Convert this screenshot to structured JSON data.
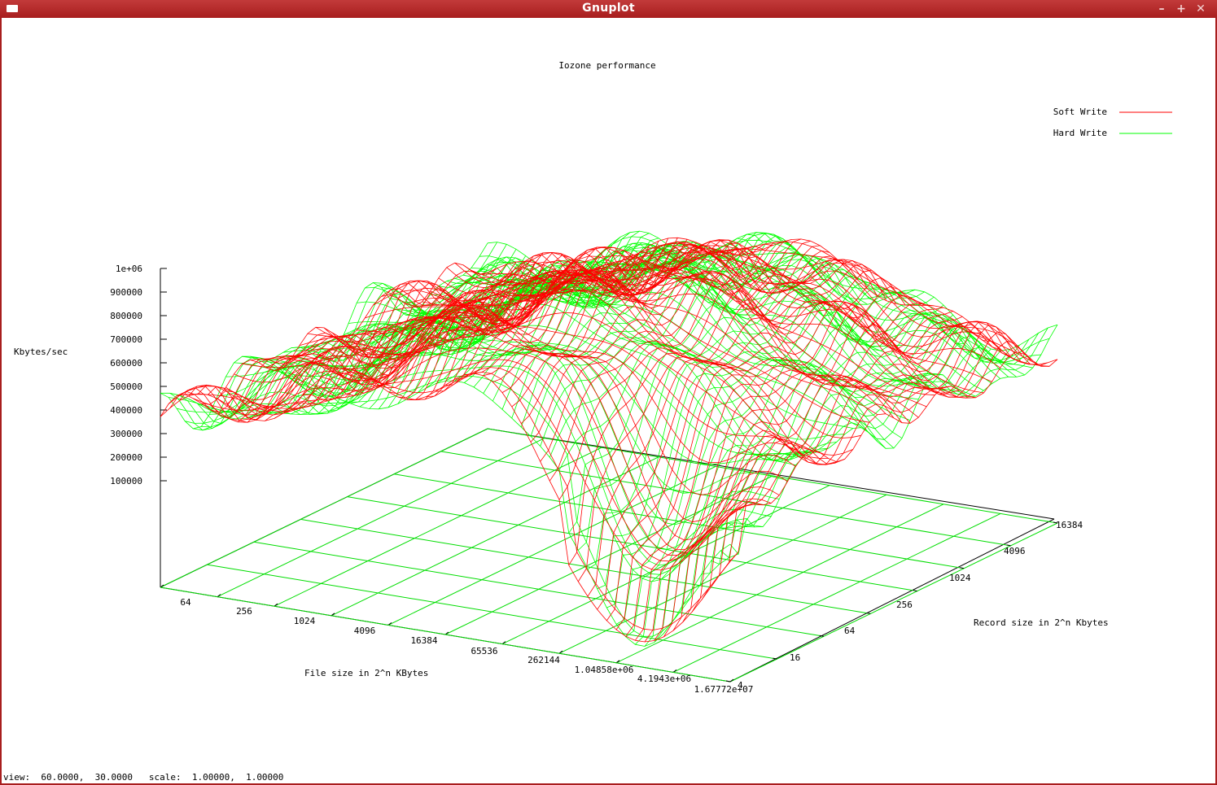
{
  "window": {
    "title": "Gnuplot"
  },
  "chart_data": {
    "type": "surface3d",
    "title": "Iozone performance",
    "zlabel": "Kbytes/sec",
    "xlabel": "File size in 2^n KBytes",
    "ylabel": "Record size in 2^n Kbytes",
    "z_ticks": [
      "1e+06",
      "900000",
      "800000",
      "700000",
      "600000",
      "500000",
      "400000",
      "300000",
      "200000",
      "100000"
    ],
    "x_ticks": [
      "64",
      "256",
      "1024",
      "4096",
      "16384",
      "65536",
      "262144",
      "1.04858e+06",
      "4.1943e+06",
      "1.67772e+07"
    ],
    "y_ticks": [
      "4",
      "16",
      "64",
      "256",
      "1024",
      "4096",
      "16384"
    ],
    "series": [
      {
        "name": "Soft Write",
        "color": "#ff0000"
      },
      {
        "name": "Hard Write",
        "color": "#00ff00"
      }
    ],
    "grid": true,
    "legend_position": "top-right"
  },
  "status": {
    "view_label": "view:",
    "view_values": "60.0000,  30.0000",
    "scale_label": "scale:",
    "scale_values": "1.00000,  1.00000"
  }
}
